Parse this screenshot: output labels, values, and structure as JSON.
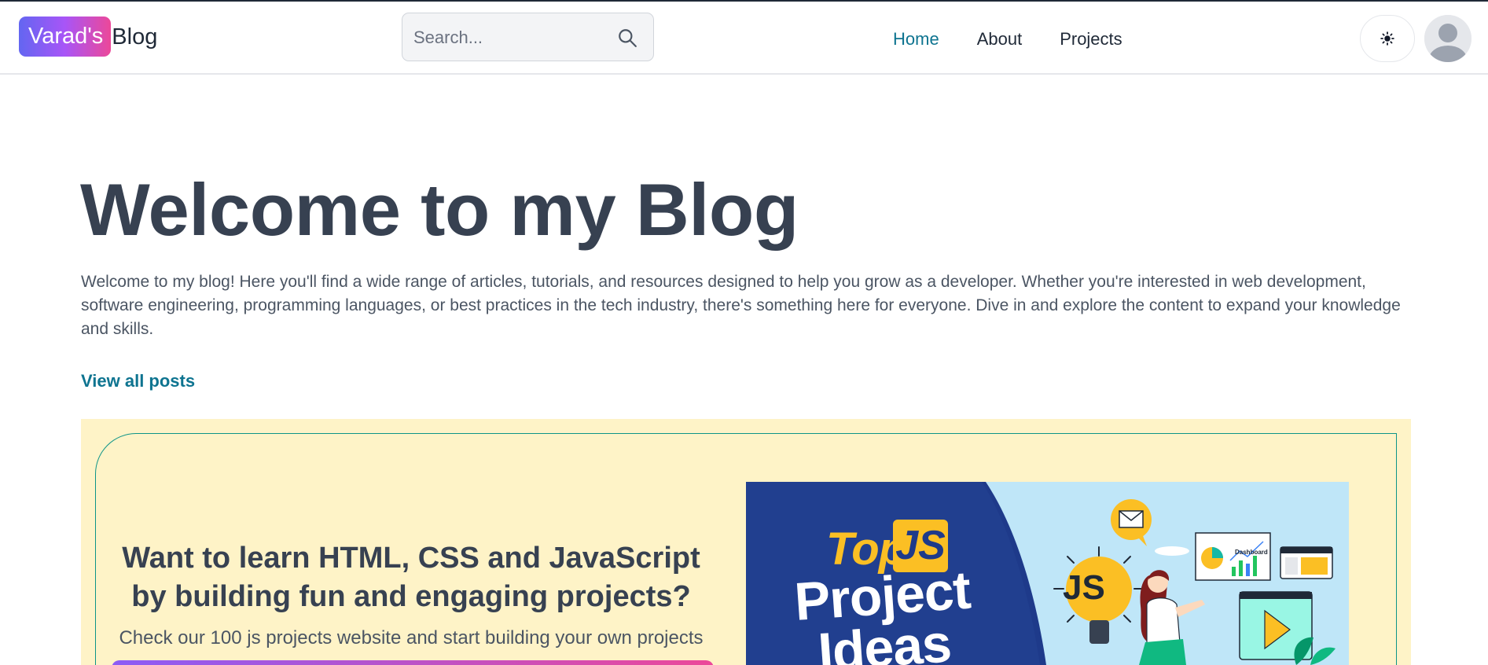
{
  "header": {
    "logo_badge": "Varad's",
    "logo_text": "Blog",
    "search_placeholder": "Search...",
    "nav": [
      {
        "label": "Home",
        "active": true
      },
      {
        "label": "About",
        "active": false
      },
      {
        "label": "Projects",
        "active": false
      }
    ],
    "theme_icon": "sun-icon",
    "avatar_icon": "user-avatar-icon"
  },
  "hero": {
    "title": "Welcome to my Blog",
    "description": "Welcome to my blog! Here you'll find a wide range of articles, tutorials, and resources designed to help you grow as a developer. Whether you're interested in web development, software engineering, programming languages, or best practices in the tech industry, there's something here for everyone. Dive in and explore the content to expand your knowledge and skills.",
    "view_all": "View all posts"
  },
  "promo": {
    "question": "Want to learn HTML, CSS and JavaScript by building fun and engaging projects?",
    "subtitle": "Check our 100 js projects website and start building your own projects",
    "image": {
      "top": "Top",
      "js": "JS",
      "project": "Project",
      "ideas": "Ideas",
      "dashboard": "Dashboard",
      "bulb_label": "JS"
    }
  },
  "colors": {
    "accent": "#0e7490",
    "promo_bg": "#fef3c7",
    "promo_border": "#0d9488",
    "logo_gradient": [
      "#6366f1",
      "#a855f7",
      "#ec4899"
    ]
  }
}
